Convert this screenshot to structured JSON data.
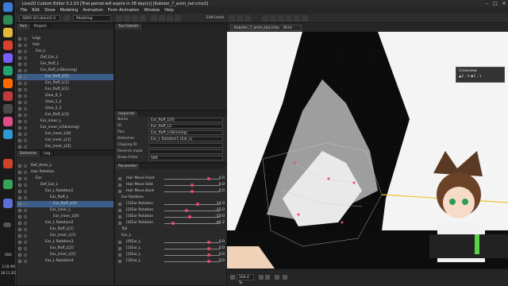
{
  "window": {
    "title": "Live2D Cubism Editor 5.1.03   [Trial period will expire in 38 day(s)]   [Kubster_7_anim_tail.cmo3]"
  },
  "menu": [
    "File",
    "Edit",
    "Show",
    "Modeling",
    "Animation",
    "Form Animation",
    "Window",
    "Help"
  ],
  "toolbar": {
    "version_select": "SDK5.0/Cubism5.0",
    "mode_select": "Modeling",
    "edit_level_label": "Edit Level"
  },
  "part_panel": {
    "tabs": [
      "Part",
      "Project"
    ],
    "rows": [
      {
        "label": "Legs",
        "indent": 20
      },
      {
        "label": "Hair",
        "indent": 20
      },
      {
        "label": "Ear_L",
        "indent": 24
      },
      {
        "label": "Def_Ear_L",
        "indent": 30
      },
      {
        "label": "Ear_fluff_L",
        "indent": 30
      },
      {
        "label": "Ear_fluff_L(Skinning)",
        "indent": 30
      },
      {
        "label": "Ear_fluff_L[0]",
        "indent": 36,
        "selected": true
      },
      {
        "label": "Ear_fluff_L[1]",
        "indent": 36
      },
      {
        "label": "Ear_fluff_L[2]",
        "indent": 36
      },
      {
        "label": "Glue_0_1",
        "indent": 36
      },
      {
        "label": "Glue_1_2",
        "indent": 36
      },
      {
        "label": "Glue_2_3",
        "indent": 36
      },
      {
        "label": "Ear_fluff_L[3]",
        "indent": 36
      },
      {
        "label": "Ear_inner_L",
        "indent": 30
      },
      {
        "label": "Ear_inner_L(Skinning)",
        "indent": 30
      },
      {
        "label": "Ear_inner_L[0]",
        "indent": 36
      },
      {
        "label": "Ear_inner_L[1]",
        "indent": 36
      },
      {
        "label": "Ear_inner_L[2]",
        "indent": 36
      }
    ]
  },
  "deformer_panel": {
    "tabs": [
      "Deformer",
      "Log"
    ],
    "rows": [
      {
        "label": "Def_Arms_L",
        "indent": 18
      },
      {
        "label": "Hair Rotation",
        "indent": 18
      },
      {
        "label": "Ear",
        "indent": 24
      },
      {
        "label": "Def_Ear_L",
        "indent": 30
      },
      {
        "label": "Ear_L Rotation1",
        "indent": 36
      },
      {
        "label": "Ear_fluff_L",
        "indent": 42
      },
      {
        "label": "Ear_fluff_L[0]",
        "indent": 46,
        "selected": true
      },
      {
        "label": "Ear_inner_L",
        "indent": 42
      },
      {
        "label": "Ear_inner_L[0]",
        "indent": 46
      },
      {
        "label": "Ear_L Rotation2",
        "indent": 36
      },
      {
        "label": "Ear_fluff_L[1]",
        "indent": 42
      },
      {
        "label": "Ear_inner_L[1]",
        "indent": 42
      },
      {
        "label": "Ear_L Rotation3",
        "indent": 36
      },
      {
        "label": "Ear_fluff_L[2]",
        "indent": 42
      },
      {
        "label": "Ear_inner_L[2]",
        "indent": 42
      },
      {
        "label": "Ear_L Rotation4",
        "indent": 36
      }
    ]
  },
  "tool_details": {
    "tab": "Tool Details"
  },
  "inspector": {
    "header": "Inspector",
    "rows": [
      {
        "key": "Name",
        "value": "Ear_fluff_L[0]"
      },
      {
        "key": "ID",
        "value": "Ear_fluff_L2"
      },
      {
        "key": "Part",
        "value": "Ear_fluff_L(Skinning)"
      },
      {
        "key": "Deformer",
        "value": "Ear_L Rotation1 (Ear_L)"
      },
      {
        "key": "Clipping ID",
        "value": ""
      },
      {
        "key": "Reverse mask",
        "value": ""
      },
      {
        "key": "Draw Order",
        "value": "500"
      }
    ]
  },
  "parameter": {
    "header": "Parameter",
    "rows": [
      {
        "label": "Hair Move Front",
        "value": "0.0",
        "pos": 0.8
      },
      {
        "label": "Hair Move Side",
        "value": "0.0",
        "pos": 0.5
      },
      {
        "label": "Hair Move Back",
        "value": "0.0",
        "pos": 0.5
      },
      {
        "label": "Ear Rotation",
        "value": "",
        "pos": -1,
        "group": true
      },
      {
        "label": "[1]Ear Rotation",
        "value": "14.0",
        "pos": 0.6
      },
      {
        "label": "[2]Ear Rotation",
        "value": "-15.0",
        "pos": 0.4
      },
      {
        "label": "[3]Ear Rotation",
        "value": "-10.0",
        "pos": 0.45
      },
      {
        "label": "[4]Ear Rotation",
        "value": "-44.2",
        "pos": 0.15
      },
      {
        "label": "Tail",
        "value": "",
        "pos": -1,
        "group": true
      },
      {
        "label": "Ear_L",
        "value": "",
        "pos": -1,
        "group": true
      },
      {
        "label": "[0]Ear_L",
        "value": "0.0",
        "pos": 0.8
      },
      {
        "label": "[1]Ear_L",
        "value": "0.0",
        "pos": 0.8
      },
      {
        "label": "[2]Ear_L",
        "value": "0.0",
        "pos": 0.8
      },
      {
        "label": "[3]Ear_L",
        "value": "0.0",
        "pos": 0.8
      }
    ]
  },
  "viewport": {
    "tabs": [
      "Kubster_7_anim_tail.cmo3",
      "Blink"
    ],
    "crossview": {
      "title": "Crossview",
      "line1": "▲2 : 4  ◆1 : 1"
    },
    "zoom": "104.4 %"
  },
  "taskbar": {
    "time": "3:18 AM",
    "date": "18.11.2025",
    "lang": "ENG"
  },
  "colors": {
    "accent": "#3b5f8a",
    "key_dot": "#e84a6a",
    "ear_black": "#0b0b0b",
    "ear_gray": "#9e9e9e"
  }
}
